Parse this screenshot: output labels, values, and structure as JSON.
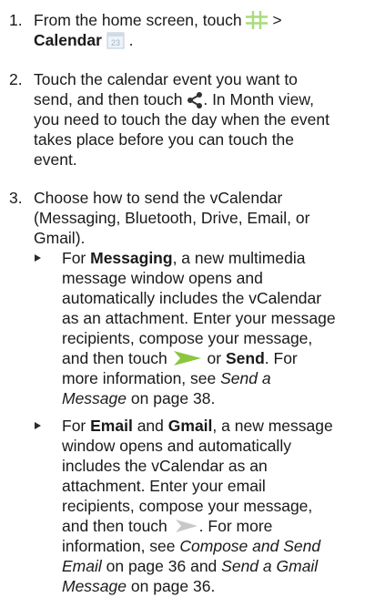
{
  "steps": [
    {
      "number": "1.",
      "line1_prefix": "From the home screen, touch",
      "line1_suffix": ">",
      "line2_bold": "Calendar",
      "calendar_icon_text": "23"
    },
    {
      "number": "2.",
      "line1": "Touch the calendar event you want to",
      "line2_prefix": "send, and then touch",
      "line2_suffix": ". In Month view,",
      "line3": "you need to touch the day when the event",
      "line4": "takes place before you can touch the",
      "line5": "event."
    },
    {
      "number": "3.",
      "line1": "Choose how to send the vCalendar",
      "line2": "(Messaging, Bluetooth, Drive, Email, or",
      "line3": "Gmail)."
    }
  ],
  "bullets": {
    "messaging": {
      "l1_pre": "For",
      "l1_bold": "Messaging",
      "l1_post": ", a new multimedia",
      "l2": "message window opens and",
      "l3": "automatically includes the vCalendar",
      "l4": "as an attachment. Enter your message",
      "l5": "recipients, compose your message,",
      "l6_pre": "and then touch",
      "l6_mid": "or",
      "l6_bold": "Send",
      "l6_post": ". For",
      "l7_pre": "more information, see",
      "l7_italic": "Send a",
      "l8_italic": "Message",
      "l8_post": "on page 38."
    },
    "email": {
      "l1_pre": "For",
      "l1_bold1": "Email",
      "l1_mid": "and",
      "l1_bold2": "Gmail",
      "l1_post": ", a new message",
      "l2": "window opens and automatically",
      "l3": "includes the vCalendar as an",
      "l4": "attachment. Enter your email",
      "l5": "recipients, compose your message,",
      "l6_pre": "and then touch",
      "l6_post": ". For more",
      "l7_pre": "information, see",
      "l7_italic": "Compose and Send",
      "l8_italic": "Email",
      "l8_mid": "on page 36 and",
      "l8_italic2": "Send a Gmail",
      "l9_italic": "Message",
      "l9_post": "on page 36."
    }
  },
  "colors": {
    "send_arrow_green": "#8cc63f",
    "send_arrow_gray": "#c8c8c8",
    "apps_grid_green": "#a8dc7a"
  },
  "icons": [
    "apps-grid-icon",
    "calendar-icon",
    "share-icon",
    "send-arrow-green-icon",
    "send-arrow-gray-icon"
  ]
}
